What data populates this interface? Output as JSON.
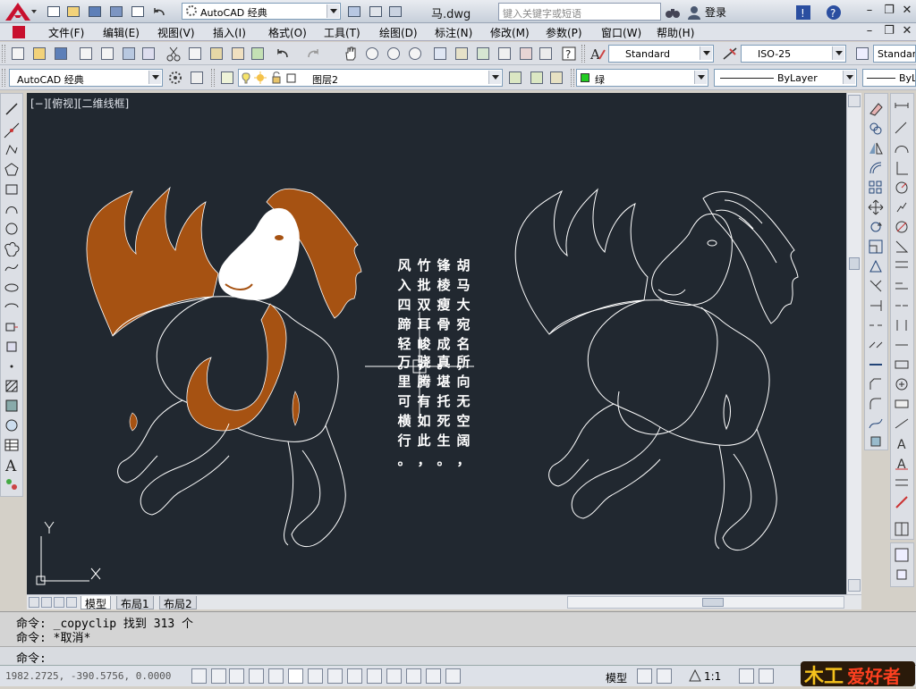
{
  "titlebar": {
    "workspace": "AutoCAD 经典",
    "document": "马.dwg",
    "search_placeholder": "键入关键字或短语",
    "login": "登录"
  },
  "menu": [
    "文件(F)",
    "编辑(E)",
    "视图(V)",
    "插入(I)",
    "格式(O)",
    "工具(T)",
    "绘图(D)",
    "标注(N)",
    "修改(M)",
    "参数(P)",
    "窗口(W)",
    "帮助(H)"
  ],
  "toolbar1": {
    "text_style": "Standard",
    "dim_style": "ISO-25",
    "table_style": "Standar"
  },
  "toolbar2": {
    "workspace": "AutoCAD 经典",
    "layer": "图层2",
    "color": "绿",
    "color_hex": "#22cc22",
    "linetype": "ByLayer",
    "lineweight": "ByL"
  },
  "viewport": {
    "label": "[−][俯视][二维线框]",
    "background": "#212830"
  },
  "poem": {
    "columns": [
      "胡马大宛名，",
      "锋棱瘦骨成。",
      "竹批双耳峻，",
      "风入四蹄轻。",
      "所向无空阔，",
      "真堪托死生。",
      "骁腾有如此，",
      "万里可横行。"
    ]
  },
  "layout_tabs": [
    "模型",
    "布局1",
    "布局2"
  ],
  "command": {
    "line1": "命令: _copyclip 找到 313 个",
    "line2": "命令: *取消*",
    "line3": "命令:"
  },
  "status": {
    "coords": "1982.2725, -390.5756, 0.0000",
    "model": "模型",
    "scale": "1:1"
  },
  "brand": "爱好者",
  "colors": {
    "horse_fill": "#a65212",
    "horse_white": "#ffffff",
    "line": "#ffffff"
  }
}
